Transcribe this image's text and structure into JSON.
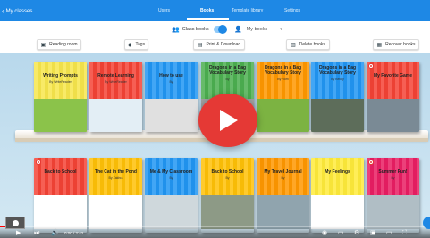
{
  "nav": {
    "back_label": "My classes",
    "tabs": [
      {
        "label": "Users"
      },
      {
        "label": "Books"
      },
      {
        "label": "Template library"
      },
      {
        "label": "Settings"
      }
    ],
    "active_tab": "Books"
  },
  "filters": {
    "class_books_label": "Class books",
    "toggle_on": true,
    "my_books_label": "My books"
  },
  "actions": {
    "reading_room": "Reading room",
    "tags": "Tags",
    "print_download": "Print & Download",
    "delete_books": "Delete books",
    "recover_books": "Recover books"
  },
  "shelf_top": [
    {
      "title": "Writing Prompts",
      "author": "By WriteReader",
      "color": "#f7e64c",
      "art": "#8bc34a"
    },
    {
      "title": "Remote Learning",
      "author": "By WriteReader",
      "color": "#f44336",
      "art": "#e3eef5"
    },
    {
      "title": "How to use",
      "author": "By",
      "color": "#2196f3",
      "art": "#e0e0e0"
    },
    {
      "title": "Dragons in a Bag Vocabulary Story",
      "author": "By",
      "color": "#4caf50",
      "art": "#9e9e9e"
    },
    {
      "title": "Dragons in a Bag Vocabulary Story",
      "author": "By Rom",
      "color": "#ff9800",
      "art": "#7cb342"
    },
    {
      "title": "Dragons in a Bag Vocabulary Story",
      "author": "By Becky",
      "color": "#2196f3",
      "art": "#5d6d5a"
    },
    {
      "title": "My Favorite Game",
      "author": "",
      "color": "#f44336",
      "art": "#7a8a95"
    }
  ],
  "shelf_bottom": [
    {
      "title": "Back to School",
      "author": "",
      "color": "#f44336",
      "art": "#ffffff"
    },
    {
      "title": "The Cat in the Pond",
      "author": "By Zakhra",
      "color": "#ffc107",
      "art": "#ffffff"
    },
    {
      "title": "Me & My Classroom",
      "author": "By",
      "color": "#2196f3",
      "art": "#cfd8dc"
    },
    {
      "title": "Back to School",
      "author": "By",
      "color": "#ffc107",
      "art": "#8d9a86"
    },
    {
      "title": "My Travel Journal",
      "author": "By",
      "color": "#ff9800",
      "art": "#90a4ae"
    },
    {
      "title": "My Feelings",
      "author": "",
      "color": "#ffeb3b",
      "art": "#ffffff"
    },
    {
      "title": "Summer Fun!",
      "author": "By",
      "color": "#e91e63",
      "art": "#b0bec5"
    }
  ],
  "video": {
    "time": "0:00 / 2:42",
    "progress": 0.04
  },
  "icons": {
    "back": "chevron-left-icon",
    "class_books": "group-icon",
    "my_books": "person-icon",
    "reading_room": "reading-room-icon",
    "tags": "tag-icon",
    "print_download": "print-icon",
    "delete_books": "trash-icon",
    "recover_books": "recover-icon",
    "play": "play-icon"
  },
  "colors": {
    "primary": "#1e88e5",
    "play": "#e53935",
    "shelf_bg": "#c9e2f0"
  }
}
